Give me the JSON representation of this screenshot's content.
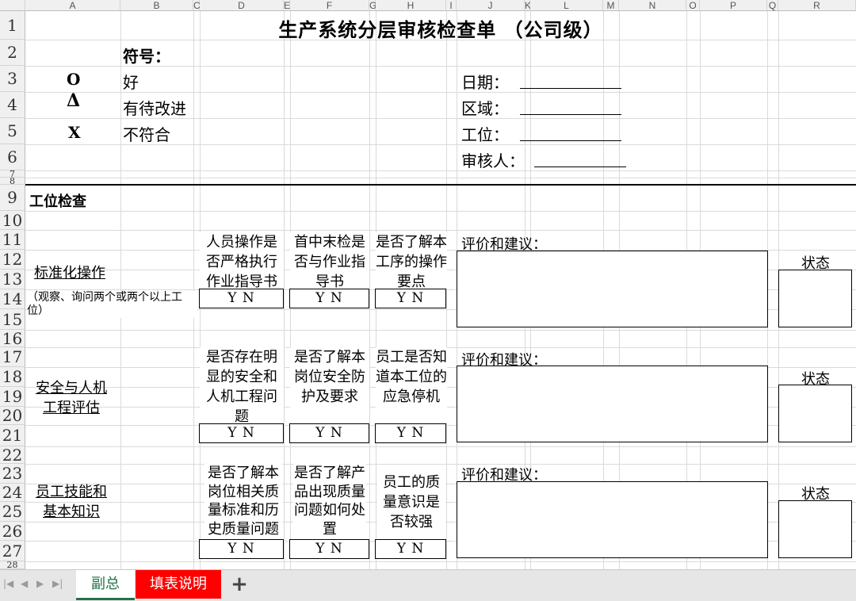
{
  "columns": [
    "A",
    "B",
    "C",
    "D",
    "E",
    "F",
    "G",
    "H",
    "I",
    "J",
    "K",
    "L",
    "M",
    "N",
    "O",
    "P",
    "Q",
    "R"
  ],
  "rows": [
    "1",
    "2",
    "3",
    "4",
    "5",
    "6",
    "7",
    "8",
    "9",
    "10",
    "11",
    "12",
    "13",
    "14",
    "15",
    "16",
    "17",
    "18",
    "19",
    "20",
    "21",
    "22",
    "23",
    "24",
    "25",
    "26",
    "27",
    "28"
  ],
  "title": "生产系统分层审核检查单 （公司级）",
  "symbols": {
    "heading": "符号：",
    "items": [
      {
        "symbol": "O",
        "meaning": "好"
      },
      {
        "symbol": "Δ",
        "meaning": "有待改进"
      },
      {
        "symbol": "X",
        "meaning": "不符合"
      }
    ]
  },
  "info_fields": [
    "日期：",
    "区域：",
    "工位：",
    "审核人："
  ],
  "section_title": "工位检查",
  "yn_label": "Y  N",
  "comment_label": "评价和建议：",
  "status_label": "状态",
  "groups": [
    {
      "name": "标准化操作",
      "note": "（观察、询问两个或两个以上工位）",
      "questions": [
        "人员操作是否严格执行作业指导书",
        "首中末检是否与作业指导书",
        "是否了解本工序的操作要点"
      ]
    },
    {
      "name": "安全与人机工程评估",
      "note": "",
      "questions": [
        "是否存在明显的安全和人机工程问题",
        "是否了解本岗位安全防护及要求",
        "员工是否知道本工位的应急停机"
      ]
    },
    {
      "name": "员工技能和基本知识",
      "note": "",
      "questions": [
        "是否了解本岗位相关质量标准和历史质量问题",
        "是否了解产品出现质量问题如何处置",
        "员工的质量意识是否较强"
      ]
    }
  ],
  "sheet_tabs": [
    {
      "label": "副总",
      "active": true
    },
    {
      "label": "填表说明",
      "active": false,
      "color": "#ff0000"
    }
  ],
  "add_sheet_icon": "plus-icon",
  "colors": {
    "accent": "#217346",
    "tab_red": "#ff0000",
    "header_bg": "#f0f0f0"
  }
}
